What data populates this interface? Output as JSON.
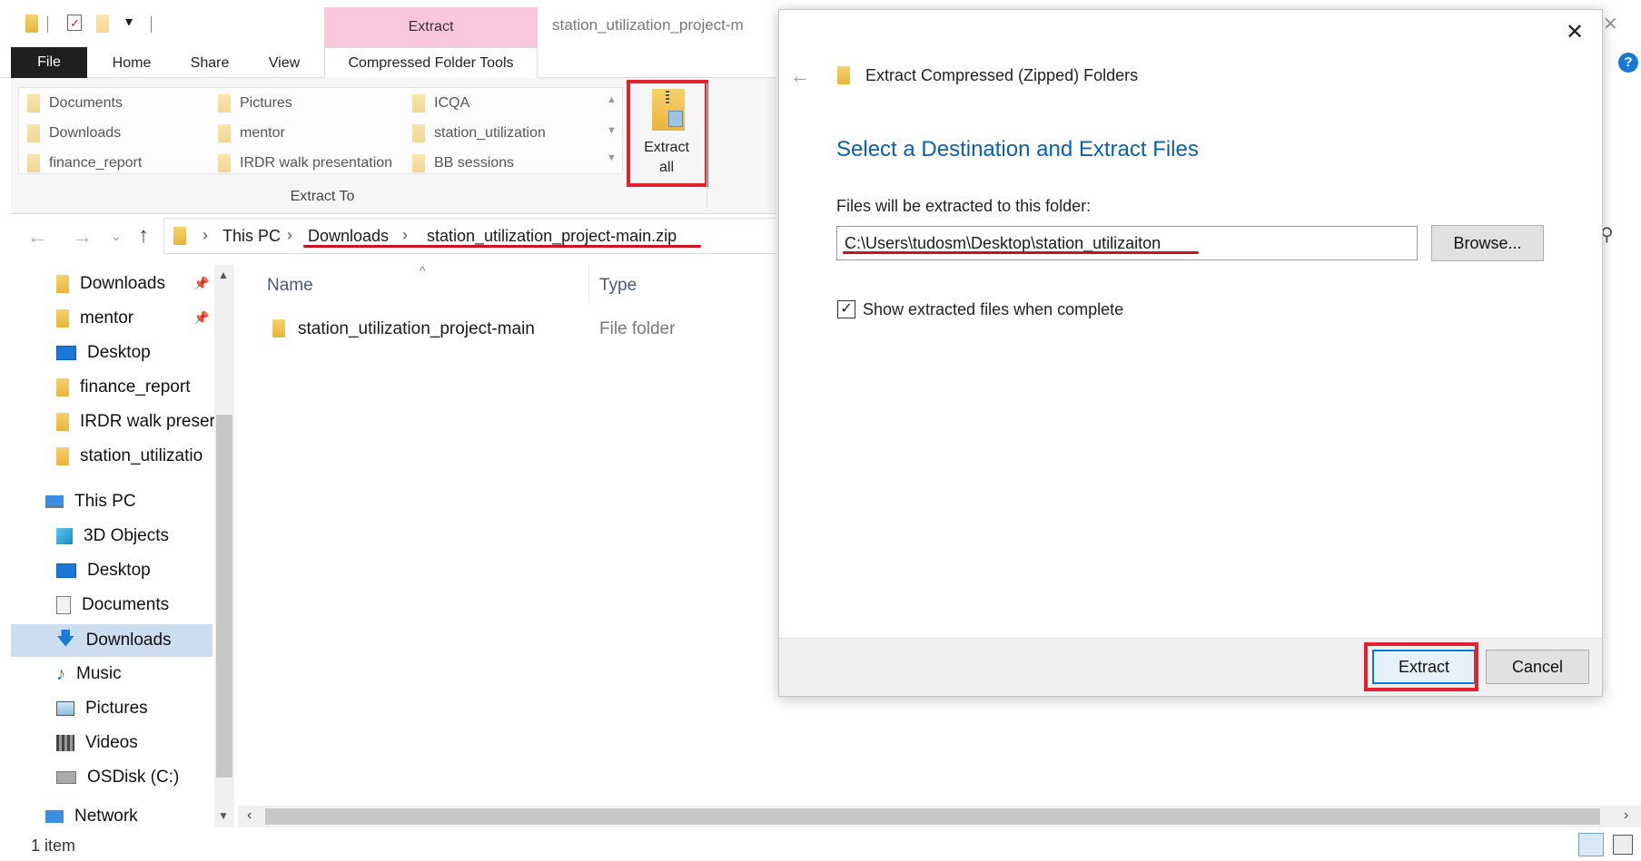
{
  "quick_access_bar": {
    "customize_label": "▾"
  },
  "ribbon": {
    "contextual_group": "Extract",
    "window_title": "station_utilization_project-m",
    "tabs": [
      "File",
      "Home",
      "Share",
      "View",
      "Compressed Folder Tools"
    ],
    "extract_to_items": [
      [
        "Documents",
        "Pictures",
        "ICQA"
      ],
      [
        "Downloads",
        "mentor",
        "station_utilization"
      ],
      [
        "finance_report",
        "IRDR walk presentation",
        "BB sessions"
      ]
    ],
    "extract_to_label": "Extract To",
    "extract_all_label_line1": "Extract",
    "extract_all_label_line2": "all"
  },
  "address_bar": {
    "crumbs": [
      "This PC",
      "Downloads",
      "station_utilization_project-main.zip"
    ]
  },
  "nav_pane": {
    "quick_access": [
      "Downloads",
      "mentor",
      "Desktop",
      "finance_report",
      "IRDR walk preser",
      "station_utilizatio"
    ],
    "this_pc_label": "This PC",
    "this_pc": [
      "3D Objects",
      "Desktop",
      "Documents",
      "Downloads",
      "Music",
      "Pictures",
      "Videos",
      "OSDisk (C:)"
    ],
    "network_label": "Network"
  },
  "file_list": {
    "col_name": "Name",
    "col_type": "Type",
    "rows": [
      {
        "name": "station_utilization_project-main",
        "type": "File folder"
      }
    ]
  },
  "status_bar": {
    "count": "1 item"
  },
  "dialog": {
    "title": "Extract Compressed (Zipped) Folders",
    "heading": "Select a Destination and Extract Files",
    "path_label": "Files will be extracted to this folder:",
    "path_value": "C:\\Users\\tudosm\\Desktop\\station_utilizaiton",
    "browse_label": "Browse...",
    "checkbox_label": "Show extracted files when complete",
    "checkbox_checked": true,
    "extract_label": "Extract",
    "cancel_label": "Cancel",
    "close_glyph": "✕",
    "back_glyph": "←"
  },
  "colors": {
    "accent": "#0a5fb4",
    "highlight": "#e2202f",
    "contextual_tab": "#fbc7dd"
  }
}
